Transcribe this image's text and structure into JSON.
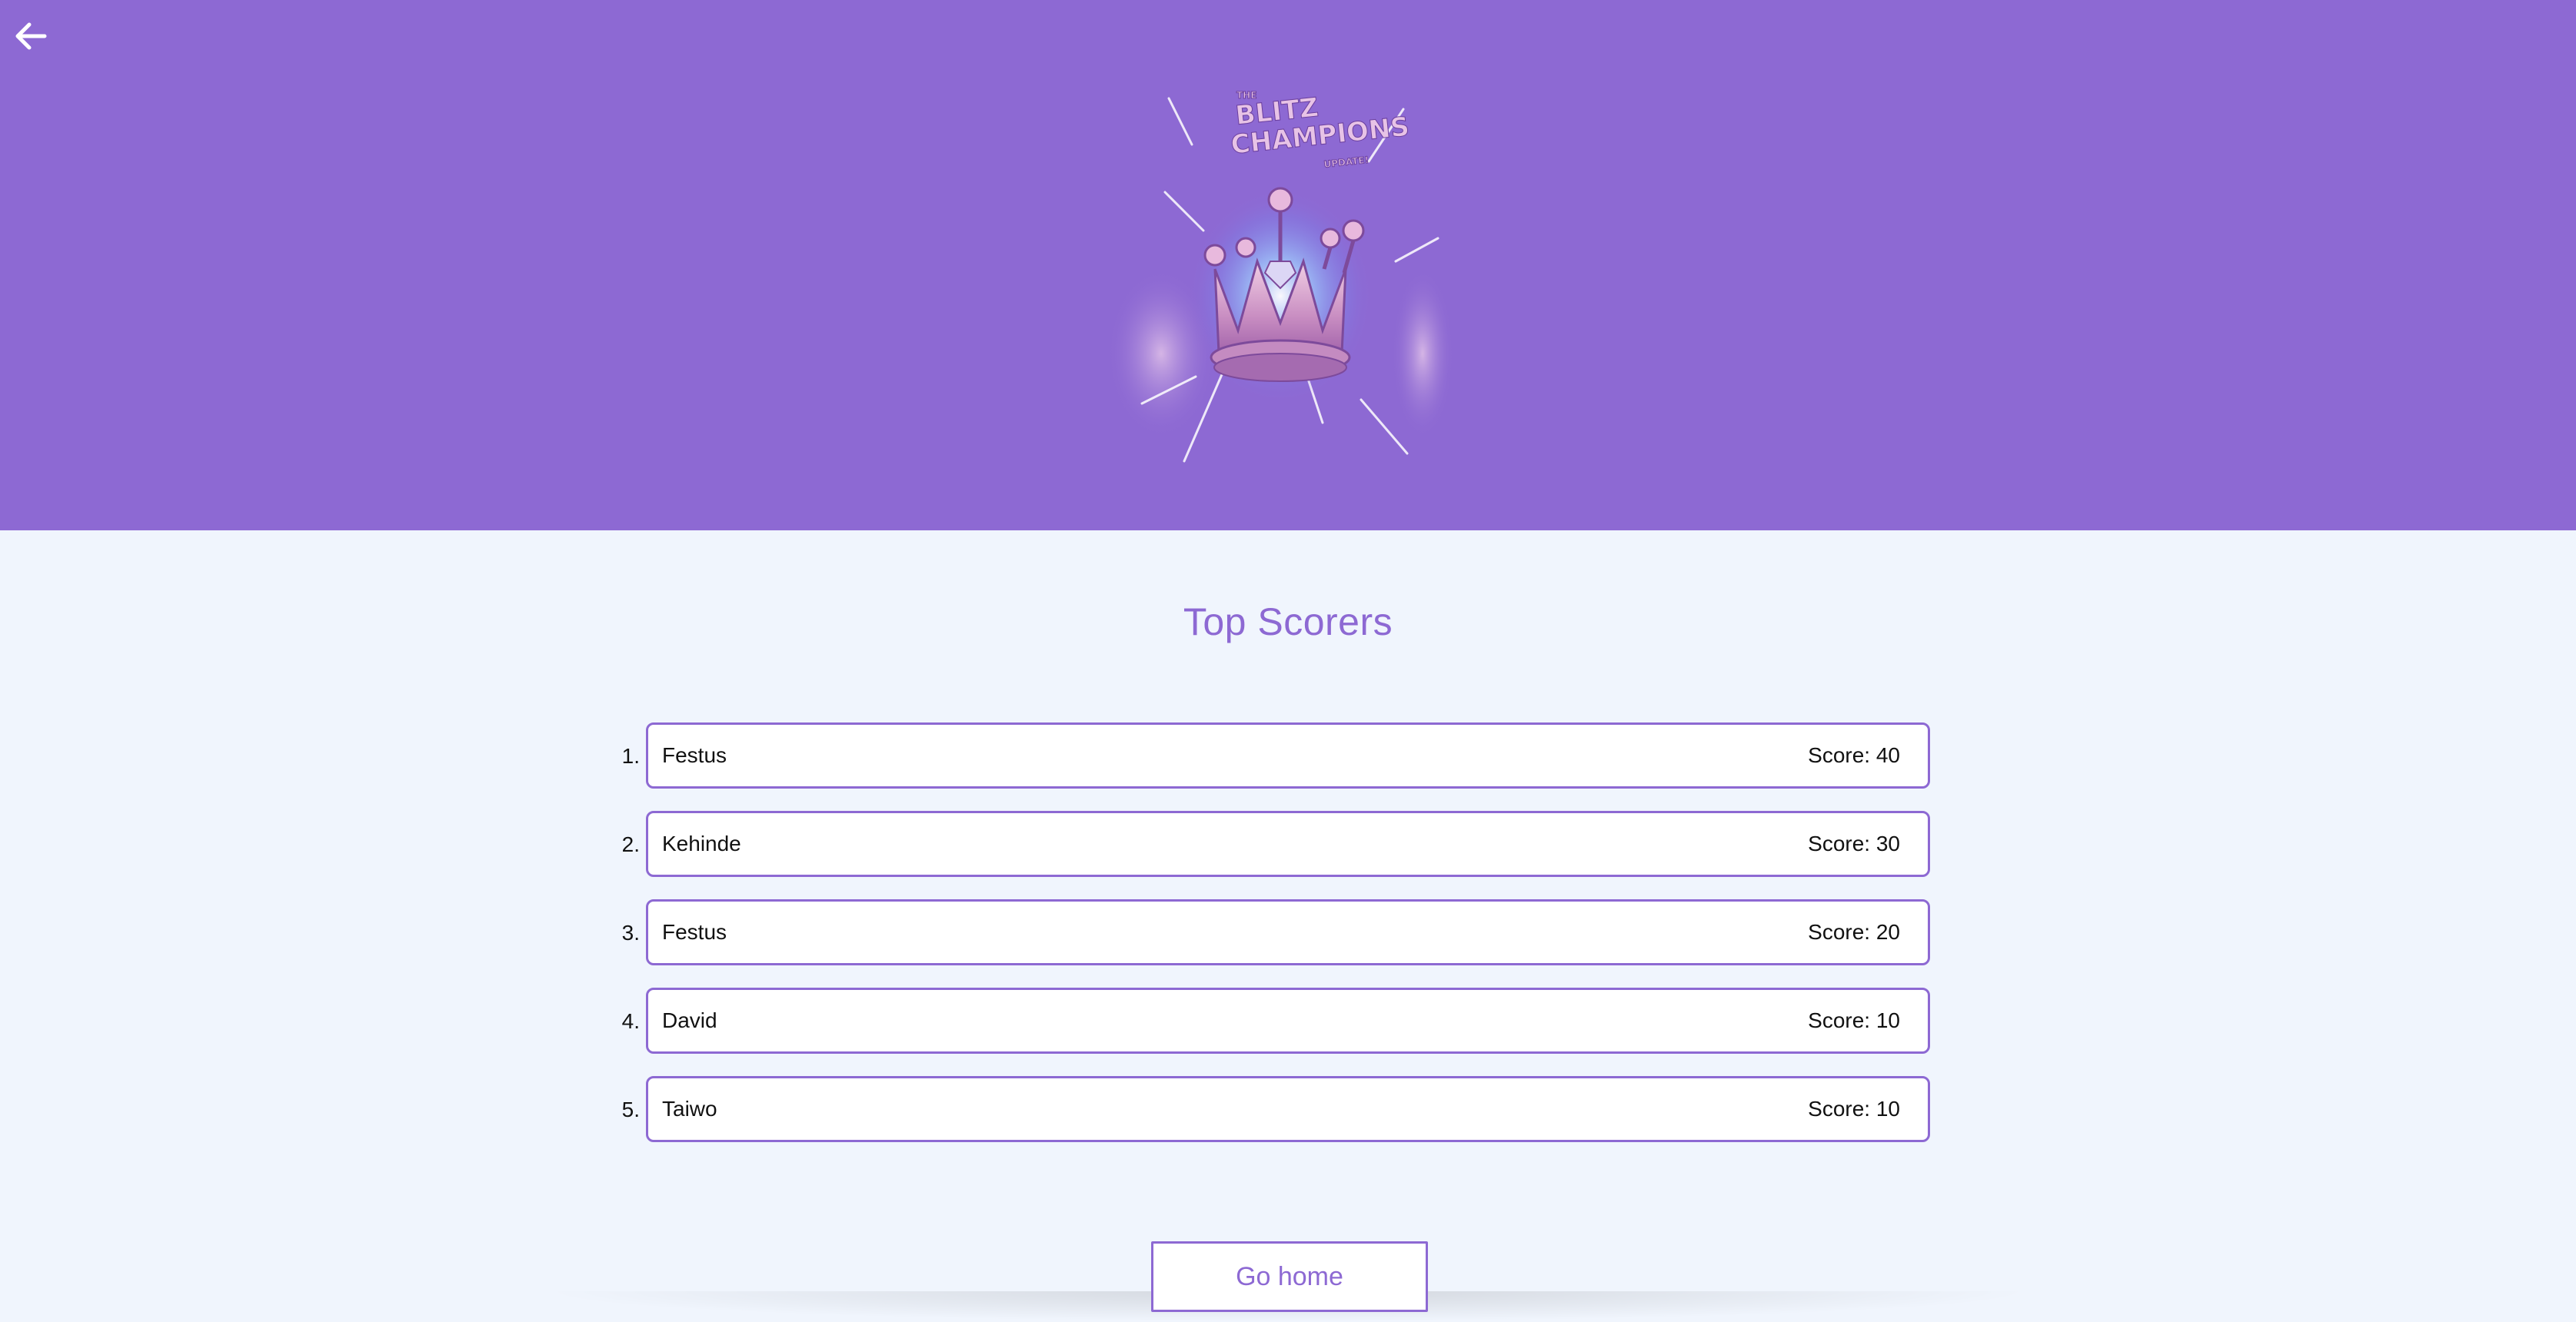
{
  "header": {
    "back_icon": "arrow-left-icon",
    "logo_text_top": "THE",
    "logo_line1": "BLITZ",
    "logo_line2": "CHAMPIONS",
    "logo_line3": "UPDATE!",
    "bg_color": "#8d69d3"
  },
  "main": {
    "title": "Top Scorers",
    "scorers": [
      {
        "rank": "1.",
        "name": "Festus",
        "score": "Score: 40"
      },
      {
        "rank": "2.",
        "name": "Kehinde",
        "score": "Score: 30"
      },
      {
        "rank": "3.",
        "name": "Festus",
        "score": "Score: 20"
      },
      {
        "rank": "4.",
        "name": "David",
        "score": "Score: 10"
      },
      {
        "rank": "5.",
        "name": "Taiwo",
        "score": "Score: 10"
      }
    ],
    "home_button": "Go home",
    "accent_color": "#8d69d3",
    "page_bg": "#f0f5fd"
  }
}
